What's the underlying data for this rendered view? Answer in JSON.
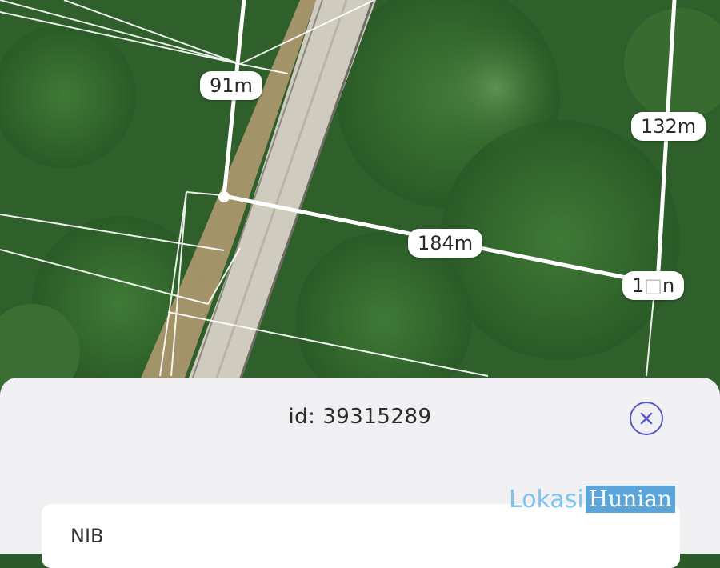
{
  "map": {
    "measurements": [
      {
        "id": "seg-91",
        "label": "91m"
      },
      {
        "id": "seg-132",
        "label": "132m"
      },
      {
        "id": "seg-184",
        "label": "184m"
      },
      {
        "id": "seg-1xn",
        "label": "1𝗇𝗇"
      }
    ]
  },
  "sheet": {
    "title": "id: 39315289",
    "close_icon": "close-circle-icon",
    "field_label": "NIB"
  },
  "watermark": {
    "part1": "Lokasi",
    "part2": "Hunian"
  },
  "colors": {
    "accent": "#5a59c8",
    "sheet_bg": "#f0f0f3",
    "watermark_light": "#7cc3ef",
    "watermark_dark": "#5aa6da"
  }
}
